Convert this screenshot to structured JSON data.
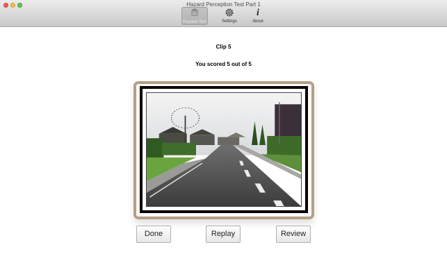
{
  "window": {
    "title": "Hazard Perception Test Part 1"
  },
  "toolbar": {
    "items": [
      {
        "label": "Practice Test",
        "icon": "practice-test-icon"
      },
      {
        "label": "Settings",
        "icon": "gear-icon"
      },
      {
        "label": "About",
        "icon": "info-icon"
      }
    ]
  },
  "main": {
    "clip_title": "Clip 5",
    "score_text": "You scored 5 out of 5",
    "frame_color": "#b69e86"
  },
  "buttons": {
    "done": "Done",
    "replay": "Replay",
    "review": "Review"
  }
}
